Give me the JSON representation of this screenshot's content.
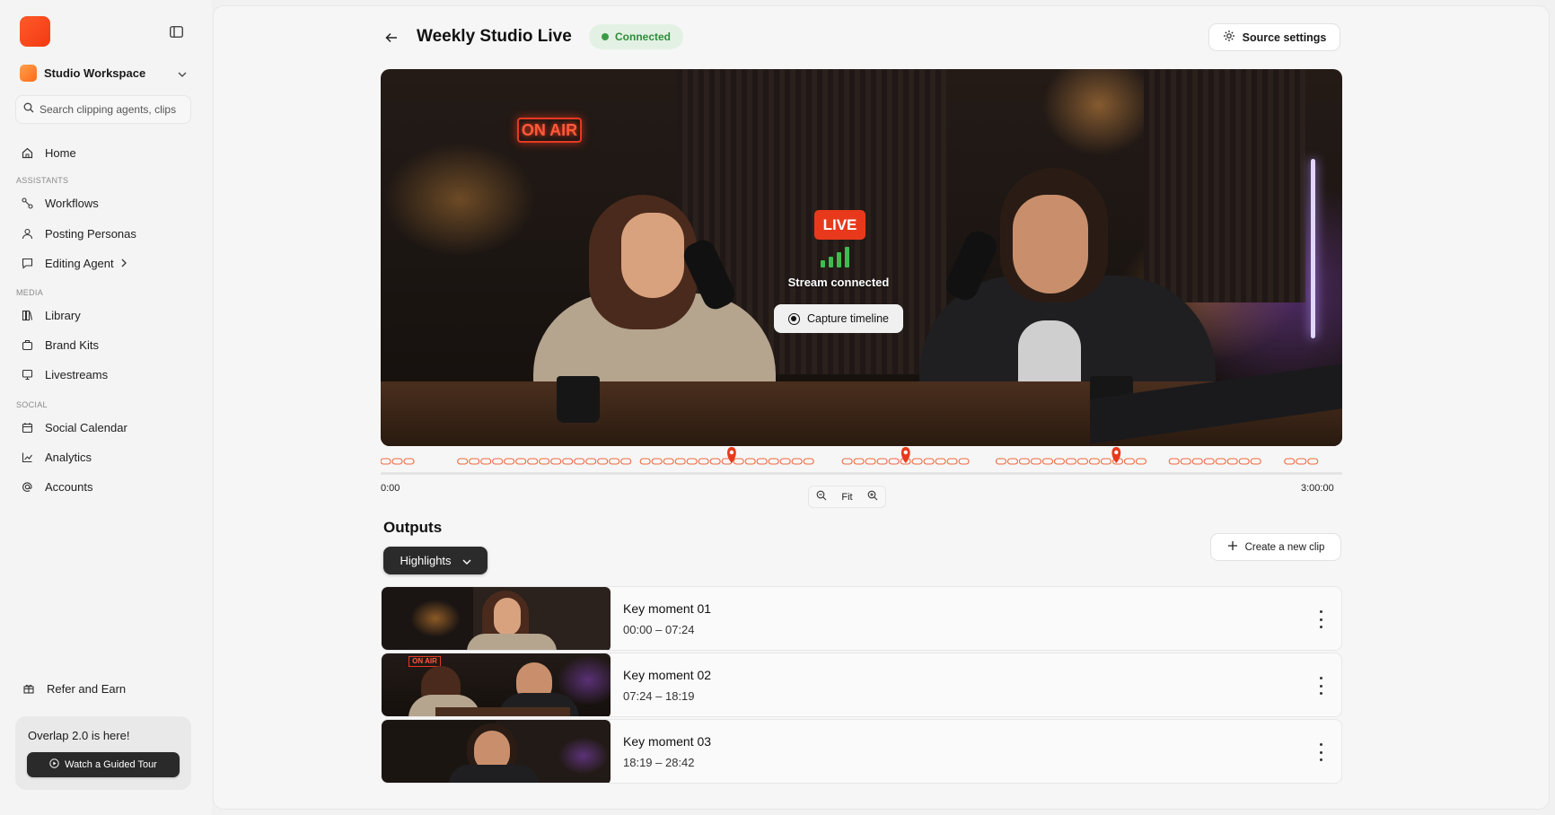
{
  "sidebar": {
    "workspace": "Studio Workspace",
    "search_placeholder": "Search clipping agents, clips",
    "home": "Home",
    "sections": {
      "assistants": "ASSISTANTS",
      "media": "MEDIA",
      "social": "SOCIAL"
    },
    "items": {
      "workflows": "Workflows",
      "posting_personas": "Posting Personas",
      "editing_agent": "Editing Agent",
      "library": "Library",
      "brand_kits": "Brand Kits",
      "livestreams": "Livestreams",
      "social_calendar": "Social Calendar",
      "analytics": "Analytics",
      "accounts": "Accounts"
    },
    "refer": "Refer and Earn",
    "promo": {
      "title": "Overlap 2.0 is here!",
      "button": "Watch a Guided Tour"
    }
  },
  "header": {
    "title": "Weekly Studio Live",
    "status": "Connected",
    "source_settings": "Source settings"
  },
  "video": {
    "live_label": "LIVE",
    "stream_status": "Stream connected",
    "capture_button": "Capture timeline",
    "sign_text": "ON AIR"
  },
  "timeline": {
    "start": "0:00",
    "end": "3:00:00",
    "fit_label": "Fit",
    "markers_fraction": [
      0.365,
      0.546,
      0.765
    ]
  },
  "outputs": {
    "title": "Outputs",
    "filter": "Highlights",
    "create_button": "Create a new clip",
    "clips": [
      {
        "title": "Key moment 01",
        "range": "00:00 – 07:24"
      },
      {
        "title": "Key moment 02",
        "range": "07:24 – 18:19"
      },
      {
        "title": "Key moment 03",
        "range": "18:19 – 28:42"
      }
    ]
  },
  "colors": {
    "accent": "#f23a12",
    "connected_bg": "#e3f1e4",
    "connected_text": "#2f8c3c",
    "live_red": "#e8391c",
    "signal_green": "#3fbb4f",
    "timeline_orange": "#f0683f"
  }
}
